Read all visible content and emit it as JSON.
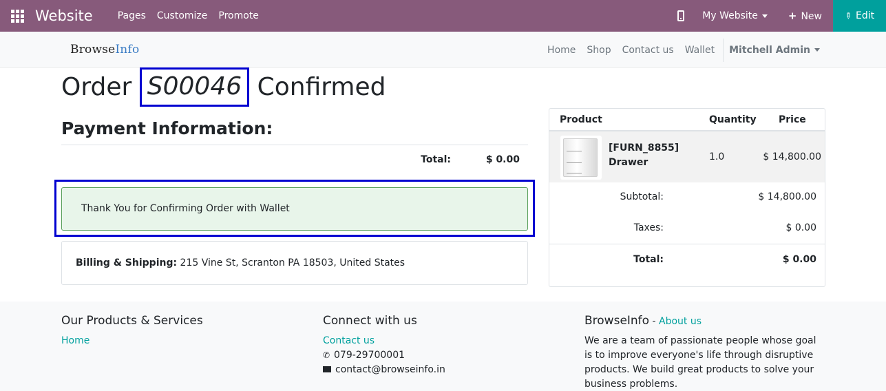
{
  "admin_bar": {
    "app_title": "Website",
    "menu": [
      "Pages",
      "Customize",
      "Promote"
    ],
    "website_select": "My Website",
    "new_label": "New",
    "edit_label": "Edit",
    "accent": "#875a7b",
    "edit_color": "#00a09d"
  },
  "header": {
    "logo_part1": "Browse",
    "logo_part2": "Info",
    "nav": [
      "Home",
      "Shop",
      "Contact us",
      "Wallet"
    ],
    "user": "Mitchell Admin"
  },
  "order": {
    "prefix": "Order",
    "number": "S00046",
    "suffix": "Confirmed"
  },
  "payment": {
    "title": "Payment Information:",
    "total_label": "Total:",
    "total_value": "$ 0.00",
    "alert": "Thank You for Confirming Order with Wallet",
    "billing_label": "Billing & Shipping:",
    "billing_address": "215 Vine St, Scranton PA 18503, United States"
  },
  "cart": {
    "headers": [
      "Product",
      "Quantity",
      "Price"
    ],
    "items": [
      {
        "line1": "[FURN_8855]",
        "line2": "Drawer",
        "quantity": "1.0",
        "price": "$ 14,800.00"
      }
    ],
    "subtotal_label": "Subtotal:",
    "subtotal_value": "$ 14,800.00",
    "taxes_label": "Taxes:",
    "taxes_value": "$ 0.00",
    "total_label": "Total:",
    "total_value": "$ 0.00"
  },
  "footer": {
    "col1_title": "Our Products & Services",
    "col1_link": "Home",
    "col2_title": "Connect with us",
    "col2_link": "Contact us",
    "phone": "079-29700001",
    "email": "contact@browseinfo.in",
    "col3_title": "BrowseInfo",
    "col3_dash": " - ",
    "col3_link": "About us",
    "about_text": "We are a team of passionate people whose goal is to improve everyone's life through disruptive products. We build great products to solve your business problems."
  }
}
